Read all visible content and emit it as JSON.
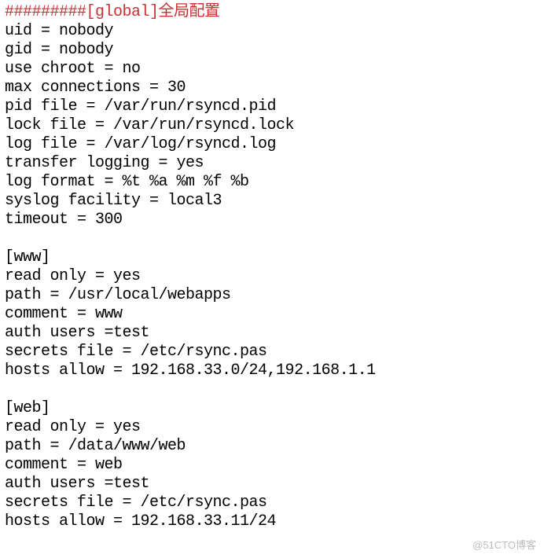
{
  "header": {
    "prefix": "#########",
    "section": "[global]",
    "cjk_label": "全局配置"
  },
  "global": {
    "uid": "uid = nobody",
    "gid": "gid = nobody",
    "use_chroot": "use chroot = no",
    "max_connections": "max connections = 30",
    "pid_file": "pid file = /var/run/rsyncd.pid",
    "lock_file": "lock file = /var/run/rsyncd.lock",
    "log_file": "log file = /var/log/rsyncd.log",
    "transfer_logging": "transfer logging = yes",
    "log_format": "log format = %t %a %m %f %b",
    "syslog_facility": "syslog facility = local3",
    "timeout": "timeout = 300"
  },
  "www": {
    "header": "[www]",
    "read_only": "read only = yes",
    "path": "path = /usr/local/webapps",
    "comment": "comment = www",
    "auth_users": "auth users =test",
    "secrets_file": "secrets file = /etc/rsync.pas",
    "hosts_allow": "hosts allow = 192.168.33.0/24,192.168.1.1"
  },
  "web": {
    "header": "[web]",
    "read_only": "read only = yes",
    "path": "path = /data/www/web",
    "comment": "comment = web",
    "auth_users": "auth users =test",
    "secrets_file": "secrets file = /etc/rsync.pas",
    "hosts_allow": "hosts allow = 192.168.33.11/24"
  },
  "watermark": "@51CTO博客"
}
